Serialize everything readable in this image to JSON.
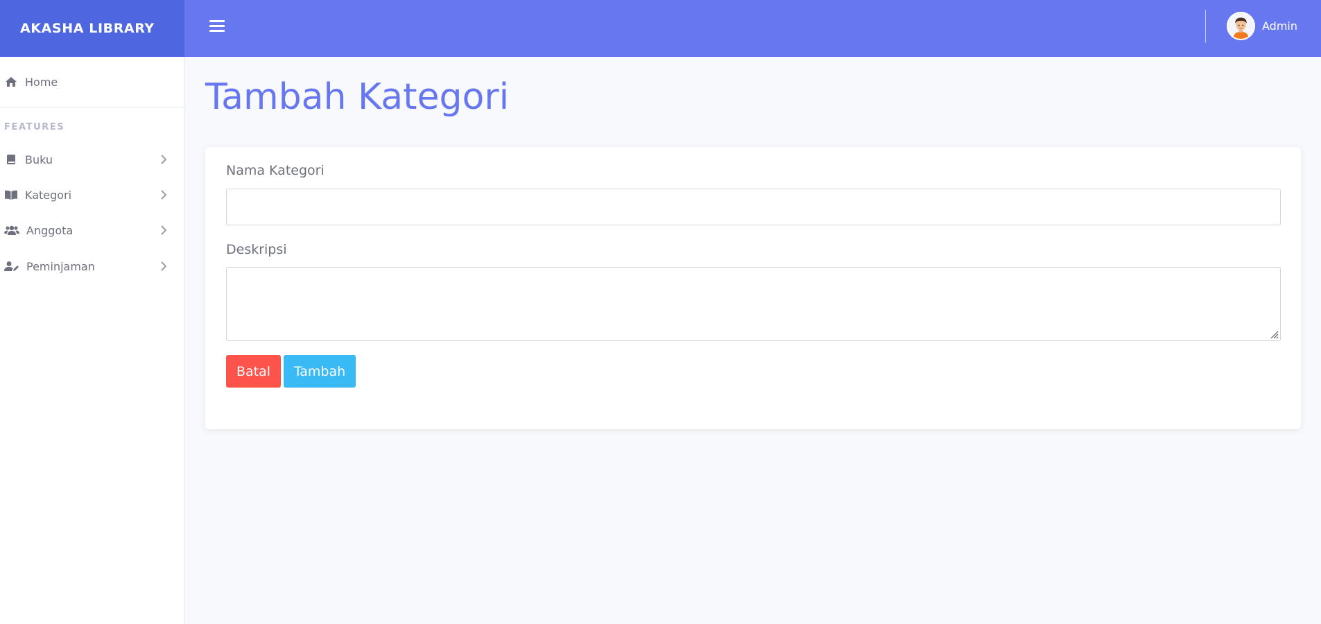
{
  "brand": {
    "name": "AKASHA LIBRARY"
  },
  "topbar": {
    "menu_icon": "hamburger-icon",
    "user_name": "Admin",
    "avatar_icon": "user-avatar"
  },
  "sidebar": {
    "home_label": "Home",
    "section_heading": "FEATURES",
    "items": [
      {
        "label": "Buku",
        "icon": "book-icon"
      },
      {
        "label": "Kategori",
        "icon": "open-book-icon"
      },
      {
        "label": "Anggota",
        "icon": "users-icon"
      },
      {
        "label": "Peminjaman",
        "icon": "user-edit-icon"
      }
    ]
  },
  "page": {
    "title": "Tambah Kategori"
  },
  "form": {
    "nama_label": "Nama Kategori",
    "nama_value": "",
    "deskripsi_label": "Deskripsi",
    "deskripsi_value": "",
    "cancel_label": "Batal",
    "submit_label": "Tambah"
  },
  "colors": {
    "brand_bg": "#4e67e0",
    "topbar_bg": "#6777ef",
    "title": "#6777ef",
    "danger": "#fc544b",
    "info": "#3abaf4"
  }
}
